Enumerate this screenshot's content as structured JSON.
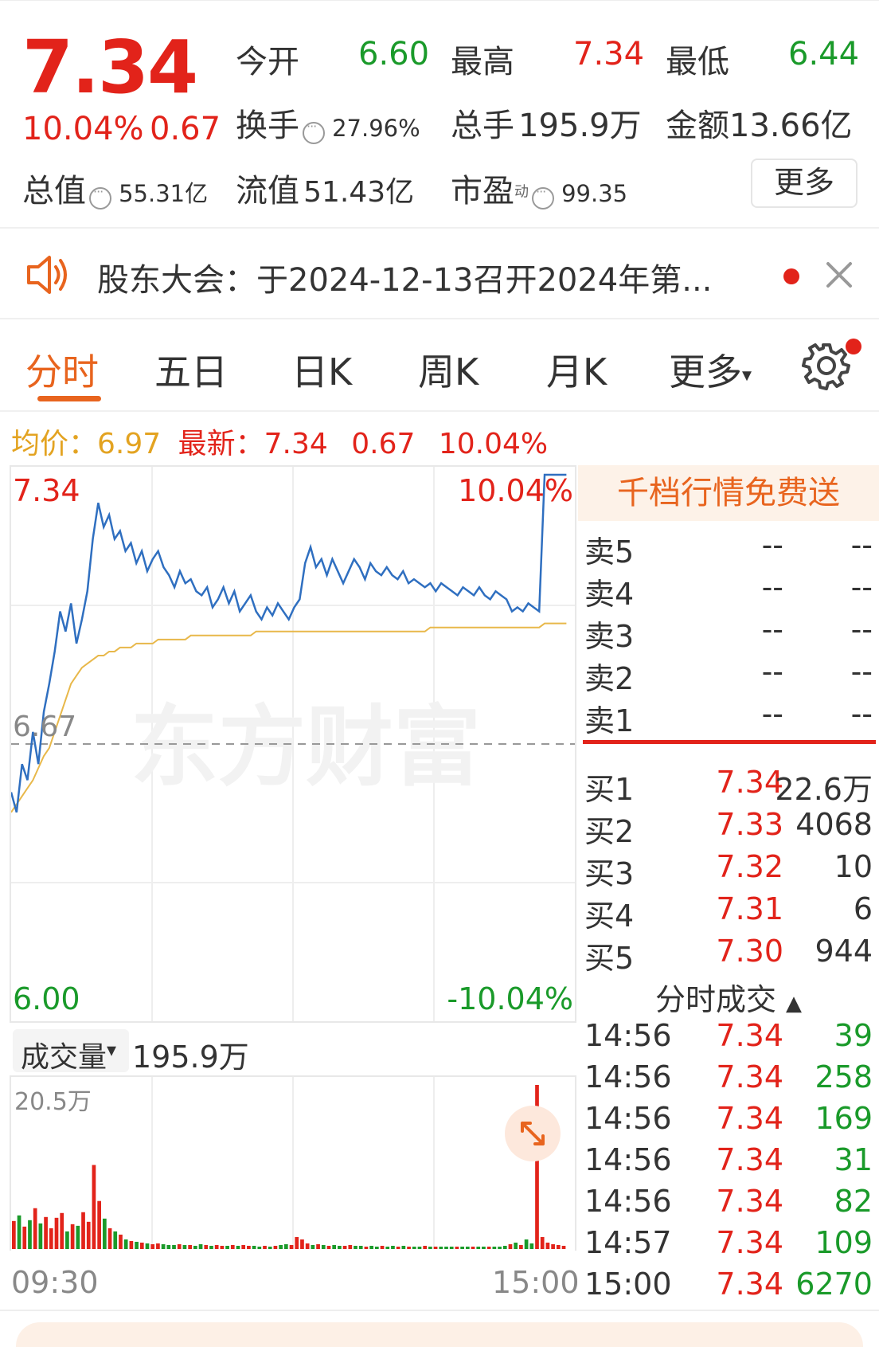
{
  "quote": {
    "price": "7.34",
    "change_pct": "10.04%",
    "change": "0.67",
    "open_label": "今开",
    "open": "6.60",
    "high_label": "最高",
    "high": "7.34",
    "low_label": "最低",
    "low": "6.44",
    "turnover_label": "换手",
    "turnover": "27.96%",
    "volume_label": "总手",
    "volume": "195.9万",
    "amount_label": "金额",
    "amount": "13.66亿",
    "mktcap_label": "总值",
    "mktcap": "55.31亿",
    "float_label": "流值",
    "float_cap": "51.43亿",
    "pe_label": "市盈",
    "pe_sup": "动",
    "pe": "99.35",
    "more": "更多"
  },
  "notice": {
    "text": "股东大会：于2024-12-13召开2024年第..."
  },
  "tabs": [
    "分时",
    "五日",
    "日K",
    "周K",
    "月K",
    "更多"
  ],
  "avg_row": {
    "avg_label": "均价：",
    "avg": "6.97",
    "latest_label": "最新：",
    "latest": "7.34",
    "change": "0.67",
    "change_pct": "10.04%"
  },
  "chart": {
    "price_max": "7.34",
    "price_min": "6.00",
    "pct_max": "10.04%",
    "pct_min": "-10.04%",
    "ref_price": "6.67",
    "watermark": "东方财富",
    "volume_label": "成交量",
    "volume_total": "195.9万",
    "vol_max": "20.5万",
    "time_start": "09:30",
    "time_end": "15:00",
    "colors": {
      "price": "#2f6fc0",
      "avg": "#e8b84a",
      "up": "#e2231a",
      "down": "#1a9a2a"
    }
  },
  "chart_data": {
    "type": "line",
    "ylim": [
      6.0,
      7.34
    ],
    "ref": 6.67,
    "series": [
      {
        "values": [
          6.55,
          6.5,
          6.62,
          6.58,
          6.7,
          6.62,
          6.75,
          6.82,
          6.9,
          7.0,
          6.95,
          7.02,
          6.92,
          6.98,
          7.05,
          7.18,
          7.27,
          7.21,
          7.24,
          7.18,
          7.2,
          7.15,
          7.17,
          7.12,
          7.15,
          7.1,
          7.13,
          7.15,
          7.11,
          7.09,
          7.06,
          7.1,
          7.07,
          7.08,
          7.05,
          7.04,
          7.06,
          7.01,
          7.03,
          7.06,
          7.02,
          7.05,
          7.0,
          7.02,
          7.04,
          7.0,
          6.98,
          7.01,
          6.99,
          7.02,
          7.0,
          6.98,
          7.01,
          7.03,
          7.12,
          7.16,
          7.11,
          7.13,
          7.09,
          7.13,
          7.1,
          7.07,
          7.1,
          7.13,
          7.11,
          7.08,
          7.12,
          7.1,
          7.09,
          7.11,
          7.09,
          7.08,
          7.1,
          7.07,
          7.08,
          7.07,
          7.06,
          7.07,
          7.05,
          7.07,
          7.06,
          7.05,
          7.04,
          7.06,
          7.05,
          7.04,
          7.06,
          7.04,
          7.03,
          7.05,
          7.04,
          7.03,
          7.0,
          7.01,
          7.0,
          7.02,
          7.01,
          7.0,
          7.34,
          7.34,
          7.34,
          7.34,
          7.34
        ]
      },
      {
        "values": [
          6.5,
          6.52,
          6.54,
          6.56,
          6.58,
          6.61,
          6.64,
          6.66,
          6.7,
          6.74,
          6.78,
          6.82,
          6.84,
          6.86,
          6.87,
          6.88,
          6.89,
          6.89,
          6.9,
          6.9,
          6.91,
          6.91,
          6.91,
          6.92,
          6.92,
          6.92,
          6.92,
          6.93,
          6.93,
          6.93,
          6.93,
          6.93,
          6.93,
          6.94,
          6.94,
          6.94,
          6.94,
          6.94,
          6.94,
          6.94,
          6.94,
          6.94,
          6.94,
          6.94,
          6.94,
          6.95,
          6.95,
          6.95,
          6.95,
          6.95,
          6.95,
          6.95,
          6.95,
          6.95,
          6.95,
          6.95,
          6.95,
          6.95,
          6.95,
          6.95,
          6.95,
          6.95,
          6.95,
          6.95,
          6.95,
          6.95,
          6.95,
          6.95,
          6.95,
          6.95,
          6.95,
          6.95,
          6.95,
          6.95,
          6.95,
          6.95,
          6.95,
          6.96,
          6.96,
          6.96,
          6.96,
          6.96,
          6.96,
          6.96,
          6.96,
          6.96,
          6.96,
          6.96,
          6.96,
          6.96,
          6.96,
          6.96,
          6.96,
          6.96,
          6.96,
          6.96,
          6.96,
          6.96,
          6.97,
          6.97,
          6.97,
          6.97,
          6.97
        ]
      }
    ],
    "volume": [
      3.5,
      4.2,
      2.8,
      3.6,
      5.1,
      3.2,
      4.0,
      2.6,
      3.9,
      4.5,
      2.2,
      3.1,
      2.9,
      4.6,
      3.4,
      10.5,
      6.0,
      3.8,
      2.6,
      2.2,
      1.8,
      1.2,
      1.0,
      0.9,
      0.8,
      0.7,
      0.6,
      0.7,
      0.6,
      0.5,
      0.5,
      0.6,
      0.5,
      0.5,
      0.4,
      0.6,
      0.5,
      0.4,
      0.5,
      0.4,
      0.4,
      0.5,
      0.4,
      0.5,
      0.4,
      0.4,
      0.3,
      0.4,
      0.3,
      0.4,
      0.5,
      0.6,
      0.5,
      1.5,
      1.2,
      0.7,
      0.5,
      0.6,
      0.5,
      0.4,
      0.5,
      0.4,
      0.4,
      0.5,
      0.4,
      0.4,
      0.3,
      0.4,
      0.3,
      0.4,
      0.3,
      0.4,
      0.3,
      0.4,
      0.3,
      0.3,
      0.3,
      0.4,
      0.3,
      0.3,
      0.3,
      0.3,
      0.3,
      0.3,
      0.3,
      0.3,
      0.3,
      0.3,
      0.3,
      0.3,
      0.3,
      0.3,
      0.4,
      0.6,
      0.8,
      0.5,
      1.2,
      0.7,
      20.5,
      1.5,
      0.8,
      0.6,
      0.5,
      0.4
    ]
  },
  "order_book": {
    "promo": "千档行情免费送",
    "asks": [
      {
        "label": "卖5",
        "price": "--",
        "vol": "--"
      },
      {
        "label": "卖4",
        "price": "--",
        "vol": "--"
      },
      {
        "label": "卖3",
        "price": "--",
        "vol": "--"
      },
      {
        "label": "卖2",
        "price": "--",
        "vol": "--"
      },
      {
        "label": "卖1",
        "price": "--",
        "vol": "--"
      }
    ],
    "bids": [
      {
        "label": "买1",
        "price": "7.34",
        "vol": "22.6万"
      },
      {
        "label": "买2",
        "price": "7.33",
        "vol": "4068"
      },
      {
        "label": "买3",
        "price": "7.32",
        "vol": "10"
      },
      {
        "label": "买4",
        "price": "7.31",
        "vol": "6"
      },
      {
        "label": "买5",
        "price": "7.30",
        "vol": "944"
      }
    ]
  },
  "trades": {
    "title": "分时成交",
    "rows": [
      {
        "time": "14:56",
        "price": "7.34",
        "vol": "39"
      },
      {
        "time": "14:56",
        "price": "7.34",
        "vol": "258"
      },
      {
        "time": "14:56",
        "price": "7.34",
        "vol": "169"
      },
      {
        "time": "14:56",
        "price": "7.34",
        "vol": "31"
      },
      {
        "time": "14:56",
        "price": "7.34",
        "vol": "82"
      },
      {
        "time": "14:57",
        "price": "7.34",
        "vol": "109"
      },
      {
        "time": "15:00",
        "price": "7.34",
        "vol": "6270"
      }
    ]
  }
}
